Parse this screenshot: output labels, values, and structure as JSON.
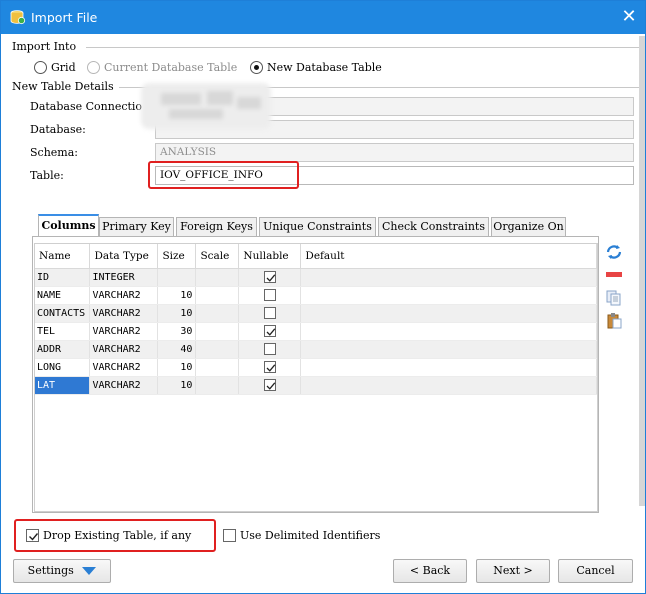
{
  "window": {
    "title": "Import File",
    "close_glyph": "✕"
  },
  "import_into": {
    "label": "Import Into",
    "options": [
      {
        "label": "Grid",
        "selected": false,
        "enabled": true
      },
      {
        "label": "Current Database Table",
        "selected": false,
        "enabled": false
      },
      {
        "label": "New Database Table",
        "selected": true,
        "enabled": true
      }
    ]
  },
  "new_table_details": {
    "label": "New Table Details",
    "database_connection_label": "Database Connectio",
    "database_label": "Database:",
    "schema_label": "Schema:",
    "schema_value": "ANALYSIS",
    "table_label": "Table:",
    "table_value": "IOV_OFFICE_INFO"
  },
  "tabs": [
    {
      "label": "Columns",
      "active": true
    },
    {
      "label": "Primary Key",
      "active": false
    },
    {
      "label": "Foreign Keys",
      "active": false
    },
    {
      "label": "Unique Constraints",
      "active": false
    },
    {
      "label": "Check Constraints",
      "active": false
    },
    {
      "label": "Organize On",
      "active": false
    }
  ],
  "columns_table": {
    "headers": [
      "Name",
      "Data Type",
      "Size",
      "Scale",
      "Nullable",
      "Default"
    ],
    "rows": [
      {
        "name": "ID",
        "type": "INTEGER",
        "size": "",
        "scale": "",
        "nullable": true,
        "default": ""
      },
      {
        "name": "NAME",
        "type": "VARCHAR2",
        "size": "10",
        "scale": "",
        "nullable": false,
        "default": ""
      },
      {
        "name": "CONTACTS",
        "type": "VARCHAR2",
        "size": "10",
        "scale": "",
        "nullable": false,
        "default": ""
      },
      {
        "name": "TEL",
        "type": "VARCHAR2",
        "size": "30",
        "scale": "",
        "nullable": true,
        "default": ""
      },
      {
        "name": "ADDR",
        "type": "VARCHAR2",
        "size": "40",
        "scale": "",
        "nullable": false,
        "default": ""
      },
      {
        "name": "LONG",
        "type": "VARCHAR2",
        "size": "10",
        "scale": "",
        "nullable": true,
        "default": ""
      },
      {
        "name": "LAT",
        "type": "VARCHAR2",
        "size": "10",
        "scale": "",
        "nullable": true,
        "default": "",
        "selected": true
      }
    ]
  },
  "side_icons": [
    "refresh-icon",
    "remove-column-icon",
    "copy-icon",
    "paste-icon"
  ],
  "options": {
    "drop_existing": {
      "label": "Drop Existing Table, if any",
      "checked": true
    },
    "delimited_identifiers": {
      "label": "Use Delimited Identifiers",
      "checked": false
    }
  },
  "buttons": {
    "settings": "Settings",
    "back": "< Back",
    "next": "Next >",
    "cancel": "Cancel"
  },
  "colors": {
    "titlebar": "#1f87e0",
    "highlight": "#e02020",
    "selection": "#2f79d3"
  }
}
